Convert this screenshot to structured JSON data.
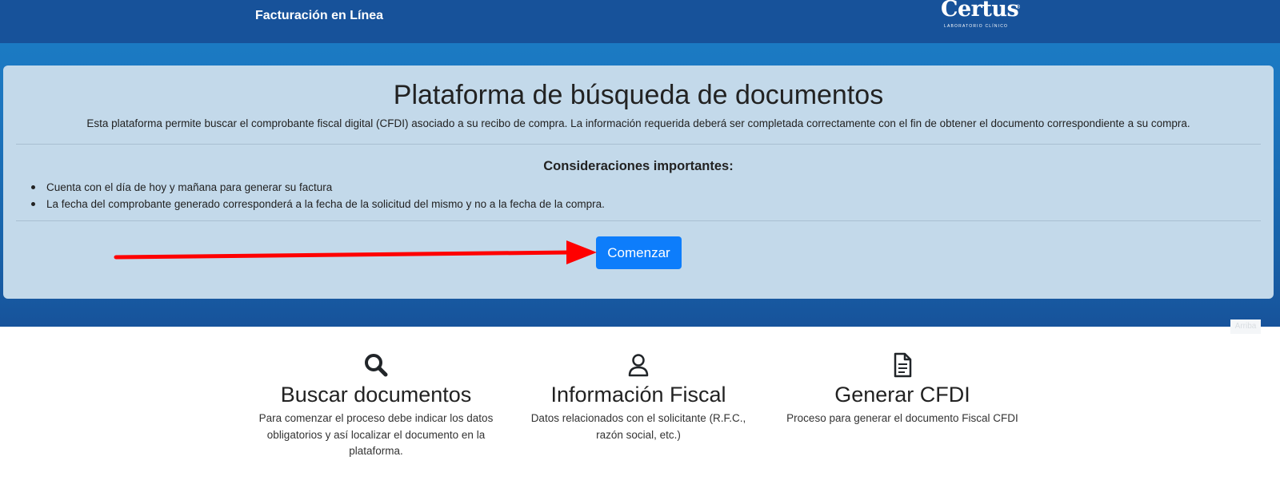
{
  "header": {
    "brand_title": "Facturación en Línea",
    "logo_text": "Certus",
    "logo_reg": "®",
    "logo_subtitle": "LABORATORIO CLÍNICO"
  },
  "hero": {
    "title": "Plataforma de búsqueda de documentos",
    "description": "Esta plataforma permite buscar el comprobante fiscal digital (CFDI) asociado a su recibo de compra. La información requerida deberá ser completada correctamente con el fin de obtener el documento correspondiente a su compra.",
    "considerations_heading": "Consideraciones importantes:",
    "considerations": [
      "Cuenta con el día de hoy y mañana para generar su factura",
      "La fecha del comprobante generado corresponderá a la fecha de la solicitud del mismo y no a la fecha de la compra."
    ],
    "start_button": "Comenzar"
  },
  "badge_text": "Arriba",
  "features": [
    {
      "icon": "search-icon",
      "title": "Buscar documentos",
      "text": "Para comenzar el proceso debe indicar los datos obligatorios y así localizar el documento en la plataforma."
    },
    {
      "icon": "user-icon",
      "title": "Información Fiscal",
      "text": "Datos relacionados con el solicitante (R.F.C., razón social, etc.)"
    },
    {
      "icon": "document-icon",
      "title": "Generar CFDI",
      "text": "Proceso para generar el documento Fiscal CFDI"
    }
  ],
  "colors": {
    "header_bg": "#17529a",
    "panel_bg": "#c3d9ea",
    "primary_button": "#0d7dfb",
    "annotation_arrow": "#ff0000"
  }
}
